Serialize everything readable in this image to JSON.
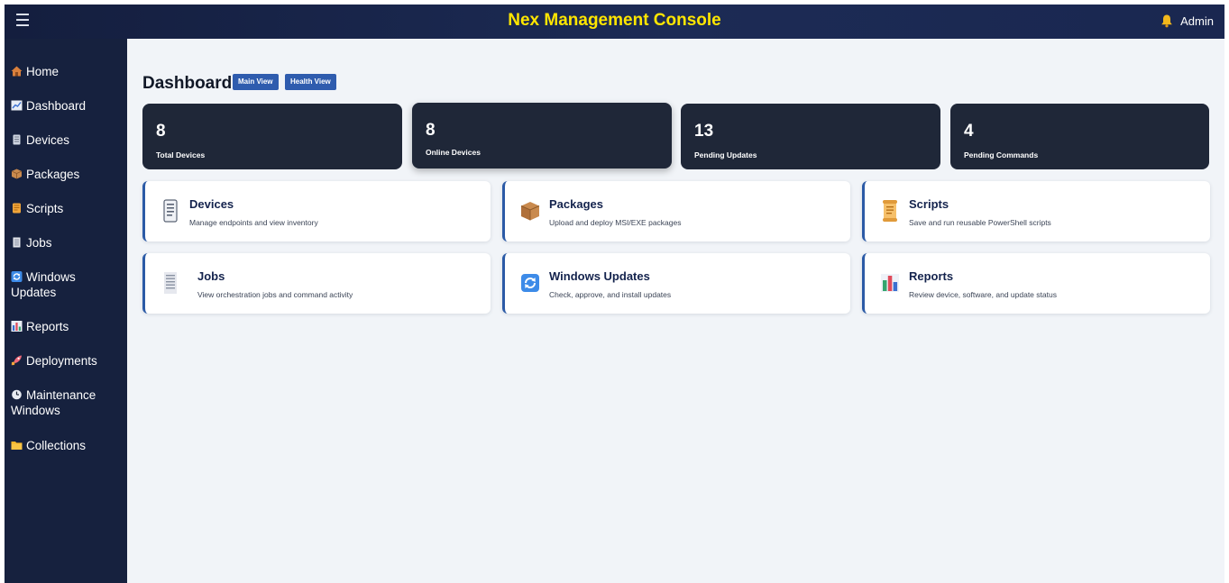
{
  "header": {
    "menu_icon": "hamburger-menu-icon",
    "title": "Nex Management Console",
    "title_color": "#ffe600",
    "user": "Admin",
    "user_icon": "bell-icon"
  },
  "sidebar": {
    "items": [
      {
        "label": "Home",
        "icon": "house-icon"
      },
      {
        "label": "Dashboard",
        "icon": "chart-icon"
      },
      {
        "label": "Devices",
        "icon": "device-icon"
      },
      {
        "label": "Packages",
        "icon": "package-icon"
      },
      {
        "label": "Scripts",
        "icon": "scroll-icon"
      },
      {
        "label": "Jobs",
        "icon": "document-icon"
      },
      {
        "label": "Windows",
        "label2": "Updates",
        "icon": "refresh-icon"
      },
      {
        "label": "Reports",
        "icon": "bar-chart-icon"
      },
      {
        "label": "Deployments",
        "icon": "rocket-icon"
      },
      {
        "label": "Maintenance",
        "label2": "Windows",
        "icon": "clock-icon"
      },
      {
        "label": "Collections",
        "icon": "folder-icon"
      }
    ]
  },
  "main": {
    "title": "Dashboard",
    "view_buttons": [
      "Main View",
      "Health View"
    ],
    "stats": [
      {
        "value": "8",
        "label": "Total Devices"
      },
      {
        "value": "8",
        "label": "Online Devices"
      },
      {
        "value": "13",
        "label": "Pending Updates"
      },
      {
        "value": "4",
        "label": "Pending Commands"
      }
    ],
    "cards": [
      {
        "title": "Devices",
        "desc": "Manage endpoints and view inventory",
        "icon": "device-icon"
      },
      {
        "title": "Packages",
        "desc": "Upload and deploy MSI/EXE packages",
        "icon": "package-icon"
      },
      {
        "title": "Scripts",
        "desc": "Save and run reusable PowerShell scripts",
        "icon": "scroll-icon"
      },
      {
        "title": "Jobs",
        "desc": "View orchestration jobs and command activity",
        "icon": "document-icon"
      },
      {
        "title": "Windows Updates",
        "desc": "Check, approve, and install updates",
        "icon": "refresh-icon"
      },
      {
        "title": "Reports",
        "desc": "Review device, software, and update status",
        "icon": "bar-chart-icon"
      }
    ]
  },
  "colors": {
    "sidebar_bg": "#16213e",
    "topbar_bg": "#1c2b55",
    "accent": "#2b5aa6",
    "stat_card_bg": "#1f2738",
    "page_bg": "#f1f4f8"
  }
}
